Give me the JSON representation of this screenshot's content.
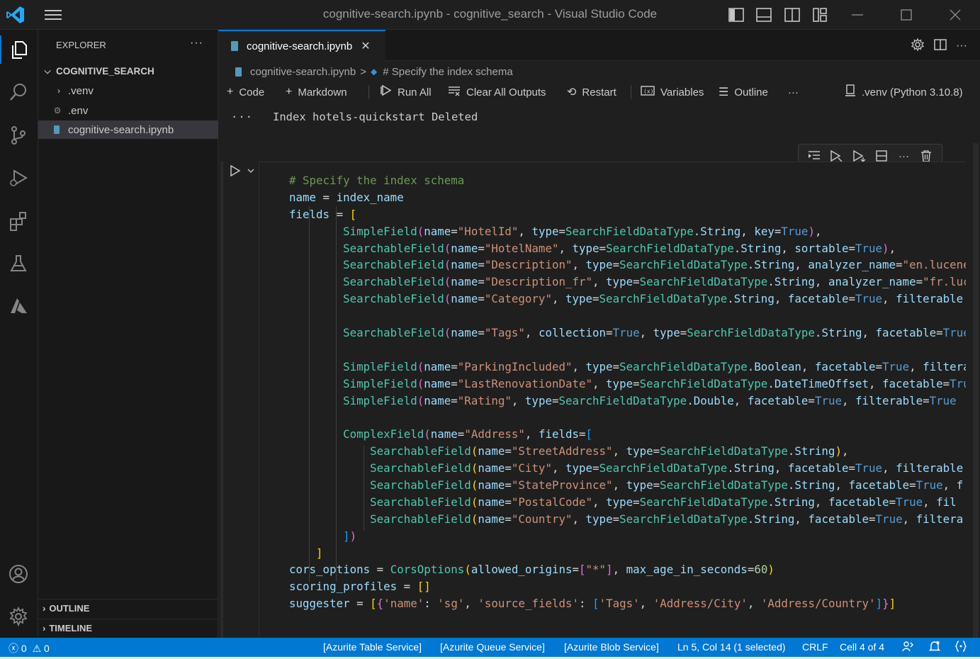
{
  "window": {
    "title": "cognitive-search.ipynb - cognitive_search - Visual Studio Code"
  },
  "explorer": {
    "header": "EXPLORER",
    "more": "···",
    "root": "COGNITIVE_SEARCH",
    "items": [
      {
        "label": ".venv",
        "kind": "folder"
      },
      {
        "label": ".env",
        "kind": "gear-file"
      },
      {
        "label": "cognitive-search.ipynb",
        "kind": "notebook"
      }
    ],
    "outline": "OUTLINE",
    "timeline": "TIMELINE"
  },
  "tab": {
    "label": "cognitive-search.ipynb",
    "close": "✕"
  },
  "breadcrumb": {
    "file": "cognitive-search.ipynb",
    "sep": ">",
    "section": "# Specify the index schema"
  },
  "toolbar": {
    "code": "Code",
    "markdown": "Markdown",
    "run_all": "Run All",
    "clear_outputs": "Clear All Outputs",
    "restart": "Restart",
    "variables": "Variables",
    "outline": "Outline",
    "more": "···",
    "kernel": ".venv (Python 3.10.8)"
  },
  "output": {
    "dots": "···",
    "text": "Index hotels-quickstart Deleted"
  },
  "code": {
    "comment": "# Specify the index schema",
    "lines": {
      "l2": [
        "name",
        " = ",
        "index_name"
      ],
      "l3": [
        "fields",
        " = ",
        "["
      ]
    }
  },
  "status": {
    "errors": "0",
    "warnings": "0",
    "azurite_table": "[Azurite Table Service]",
    "azurite_queue": "[Azurite Queue Service]",
    "azurite_blob": "[Azurite Blob Service]",
    "position": "Ln 5, Col 14 (1 selected)",
    "eol": "CRLF",
    "cell": "Cell 4 of 4"
  },
  "colors": {
    "accent": "#0078d4",
    "statusbar": "#0078d4",
    "string": "#ce9178",
    "class": "#4ec9b0",
    "keyword": "#569cd6",
    "variable": "#9cdcfe",
    "comment": "#6a9955"
  }
}
